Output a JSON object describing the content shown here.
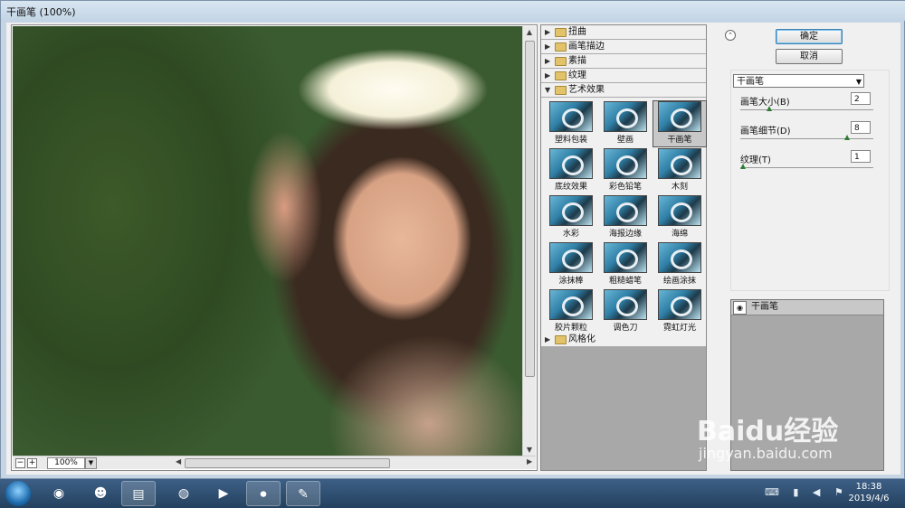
{
  "window": {
    "title": "干画笔 (100%)"
  },
  "preview": {
    "zoom_minus": "−",
    "zoom_plus": "+",
    "zoom_value": "100%"
  },
  "gallery": {
    "categories_top": [
      {
        "label": "扭曲"
      },
      {
        "label": "画笔描边"
      },
      {
        "label": "素描"
      },
      {
        "label": "纹理"
      },
      {
        "label": "艺术效果"
      }
    ],
    "filters": [
      {
        "name": "塑料包装"
      },
      {
        "name": "壁画"
      },
      {
        "name": "干画笔",
        "selected": true
      },
      {
        "name": "底纹效果"
      },
      {
        "name": "彩色铅笔"
      },
      {
        "name": "木刻"
      },
      {
        "name": "水彩"
      },
      {
        "name": "海报边缘"
      },
      {
        "name": "海绵"
      },
      {
        "name": "涂抹棒"
      },
      {
        "name": "粗糙蜡笔"
      },
      {
        "name": "绘画涂抹"
      },
      {
        "name": "胶片颗粒"
      },
      {
        "name": "调色刀"
      },
      {
        "name": "霓虹灯光"
      }
    ],
    "categories_bottom": [
      {
        "label": "风格化"
      }
    ]
  },
  "panel": {
    "ok_label": "确定",
    "cancel_label": "取消",
    "filter_select": "干画笔",
    "params": [
      {
        "label": "画笔大小(B)",
        "value": "2",
        "fraction": 0.2
      },
      {
        "label": "画笔细节(D)",
        "value": "8",
        "fraction": 0.8
      },
      {
        "label": "纹理(T)",
        "value": "1",
        "fraction": 0.0
      }
    ],
    "layer_name": "干画笔"
  },
  "taskbar": {
    "time": "18:38",
    "date": "2019/4/6"
  },
  "watermark": {
    "brand": "Baidu经验",
    "url": "jingyan.baidu.com"
  }
}
